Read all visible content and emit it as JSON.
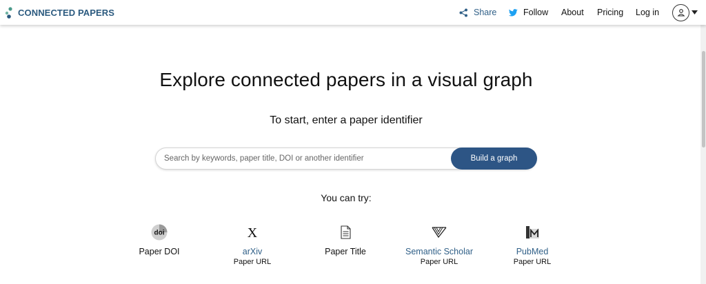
{
  "header": {
    "logo_text": "CONNECTED PAPERS",
    "nav": {
      "share": "Share",
      "follow": "Follow",
      "about": "About",
      "pricing": "Pricing",
      "login": "Log in"
    }
  },
  "main": {
    "title": "Explore connected papers in a visual graph",
    "subtitle": "To start, enter a paper identifier",
    "search": {
      "placeholder": "Search by keywords, paper title, DOI or another identifier",
      "value": ""
    },
    "build_button": "Build a graph",
    "try_label": "You can try:",
    "examples": [
      {
        "label": "Paper DOI",
        "sub": "",
        "icon": "doi-icon"
      },
      {
        "label": "arXiv",
        "sub": "Paper URL",
        "icon": "arxiv-icon"
      },
      {
        "label": "Paper Title",
        "sub": "",
        "icon": "document-icon"
      },
      {
        "label": "Semantic Scholar",
        "sub": "Paper URL",
        "icon": "semantic-scholar-icon"
      },
      {
        "label": "PubMed",
        "sub": "Paper URL",
        "icon": "pubmed-icon"
      }
    ]
  },
  "colors": {
    "brand": "#2b5a7f",
    "link": "#2f5f87",
    "button": "#2d5585",
    "logo_accent": "#4a9a8a"
  }
}
